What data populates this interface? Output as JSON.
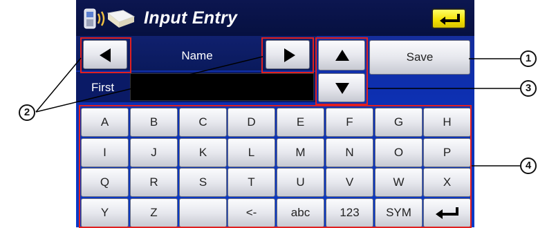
{
  "title": "Input Entry",
  "name_field": {
    "label": "Name",
    "row_label": "First",
    "value": ""
  },
  "save_label": "Save",
  "keyboard_rows": [
    [
      "A",
      "B",
      "C",
      "D",
      "E",
      "F",
      "G",
      "H"
    ],
    [
      "I",
      "J",
      "K",
      "L",
      "M",
      "N",
      "O",
      "P"
    ],
    [
      "Q",
      "R",
      "S",
      "T",
      "U",
      "V",
      "W",
      "X"
    ],
    [
      "Y",
      "Z",
      "",
      "<-",
      "abc",
      "123",
      "SYM",
      "enter"
    ]
  ],
  "callouts": [
    "1",
    "2",
    "3",
    "4"
  ],
  "colors": {
    "highlight": "#e02020",
    "enter_button": "#f3e000",
    "screen_bg": "#0a3bc9"
  },
  "icons": {
    "app": "phone-book-icon",
    "enter": "enter-arrow-icon",
    "left": "left-arrow-icon",
    "right": "right-arrow-icon",
    "up": "up-arrow-icon",
    "down": "down-arrow-icon"
  }
}
